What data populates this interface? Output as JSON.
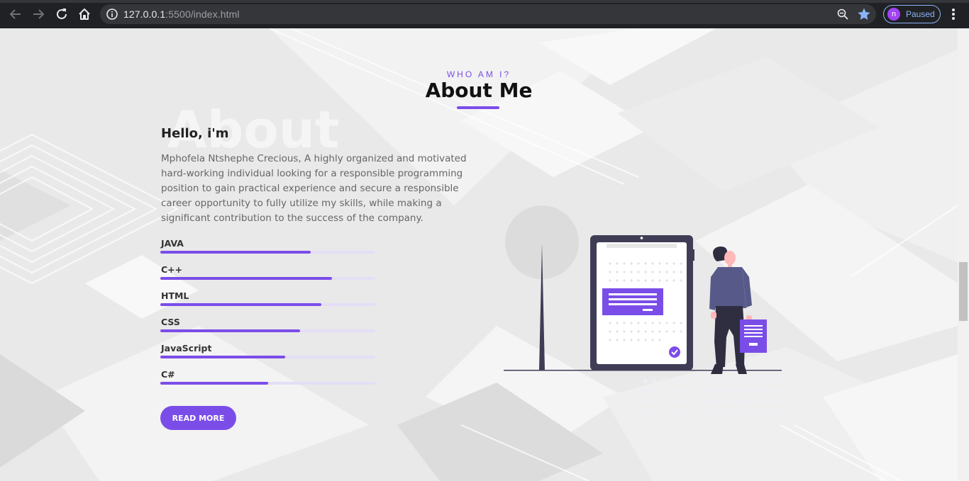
{
  "browser": {
    "url_host": "127.0.0.1",
    "url_rest": ":5500/index.html",
    "profile_initial": "n",
    "profile_status": "Paused"
  },
  "about": {
    "subtitle": "WHO AM I?",
    "title": "About Me",
    "ghost_text": "About",
    "greeting": "Hello, i'm",
    "bio": "Mphofela Ntshephe Crecious, A highly organized and motivated hard-working individual looking for a responsible programming position to gain practical experience and secure a responsible career opportunity to fully utilize my skills, while making a significant contribution to the success of the company.",
    "read_more": "READ MORE"
  },
  "skills": [
    {
      "name": "JAVA",
      "level": 0.7
    },
    {
      "name": "C++",
      "level": 0.8
    },
    {
      "name": "HTML",
      "level": 0.75
    },
    {
      "name": "CSS",
      "level": 0.65
    },
    {
      "name": "JavaScript",
      "level": 0.58
    },
    {
      "name": "C#",
      "level": 0.5
    }
  ],
  "colors": {
    "accent": "#7b4de8",
    "track": "#e4def7",
    "chrome_bg": "#202124",
    "omnibox_bg": "#35363a"
  },
  "icons": [
    "back-arrow-icon",
    "forward-arrow-icon",
    "reload-icon",
    "home-icon",
    "info-icon",
    "zoom-icon",
    "star-icon",
    "kebab-menu-icon"
  ]
}
